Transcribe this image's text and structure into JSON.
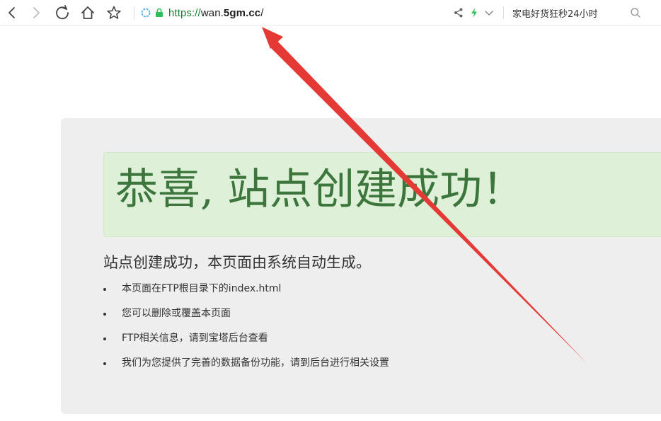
{
  "toolbar": {
    "url_scheme": "https://",
    "url_host_prefix": "wan.",
    "url_host_domain": "5gm.cc",
    "url_path": "/",
    "search_text": "家电好货狂秒24小时"
  },
  "icons": {
    "back": "back-arrow-icon",
    "forward": "forward-arrow-icon",
    "reload": "reload-icon",
    "home": "home-icon",
    "bookmark": "star-icon",
    "site": "security-shield-icon",
    "lock": "lock-icon",
    "share": "share-icon",
    "speed": "lightning-icon",
    "dropdown": "chevron-down-icon",
    "search": "search-icon"
  },
  "colors": {
    "success_bg": "#dff0d8",
    "success_text": "#3c763d",
    "panel_bg": "#eeeeee",
    "arrow": "#e53935"
  },
  "page": {
    "heading": "恭喜, 站点创建成功！",
    "lead": "站点创建成功，本页面由系统自动生成。",
    "items": [
      "本页面在FTP根目录下的index.html",
      "您可以删除或覆盖本页面",
      "FTP相关信息，请到宝塔后台查看",
      "我们为您提供了完善的数据备份功能，请到后台进行相关设置"
    ]
  }
}
